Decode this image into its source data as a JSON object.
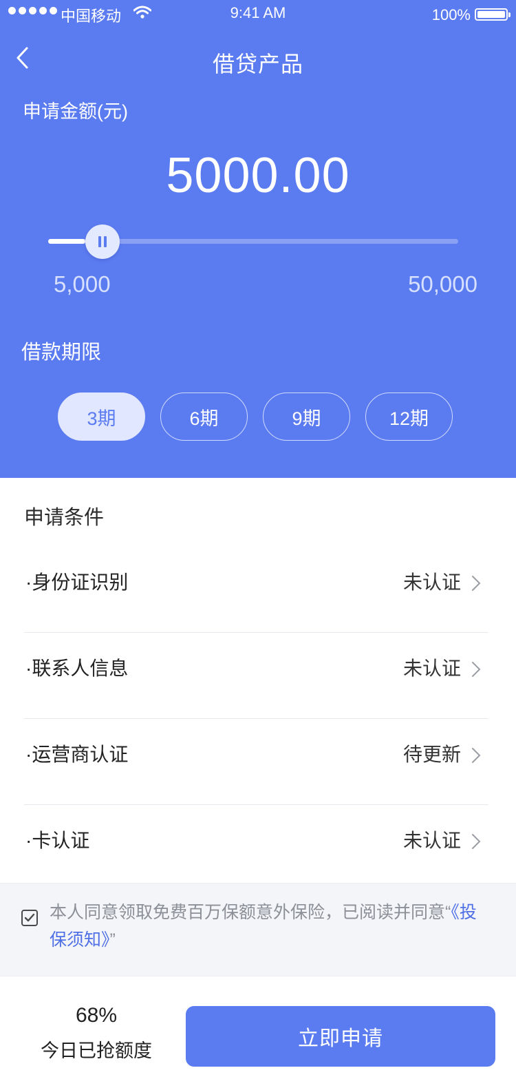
{
  "status_bar": {
    "carrier": "中国移动",
    "time": "9:41 AM",
    "battery": "100%"
  },
  "nav": {
    "title": "借贷产品",
    "back_icon": "chevron-left-icon"
  },
  "loan": {
    "amount_label": "申请金额(元)",
    "amount_value": "5000.00",
    "slider": {
      "min_label": "5,000",
      "max_label": "50,000",
      "level": 0.09
    },
    "term_label": "借款期限",
    "terms": [
      {
        "label": "3期",
        "active": true
      },
      {
        "label": "6期",
        "active": false
      },
      {
        "label": "9期",
        "active": false
      },
      {
        "label": "12期",
        "active": false
      }
    ]
  },
  "conditions": {
    "title": "申请条件",
    "items": [
      {
        "name": "·身份证识别",
        "status": "未认证"
      },
      {
        "name": "·联系人信息",
        "status": "未认证"
      },
      {
        "name": "·运营商认证",
        "status": "待更新"
      },
      {
        "name": "·卡认证",
        "status": "未认证"
      }
    ]
  },
  "agreement": {
    "checked": true,
    "text": "本人同意领取免费百万保额意外保险，已阅读并同意“",
    "link": "《投保须知》",
    "text_end": "”"
  },
  "footer": {
    "quota_percent": "68%",
    "quota_label": "今日已抢额度",
    "apply_label": "立即申请"
  },
  "colors": {
    "primary": "#5b7bf0",
    "link": "#4f6fe6"
  }
}
